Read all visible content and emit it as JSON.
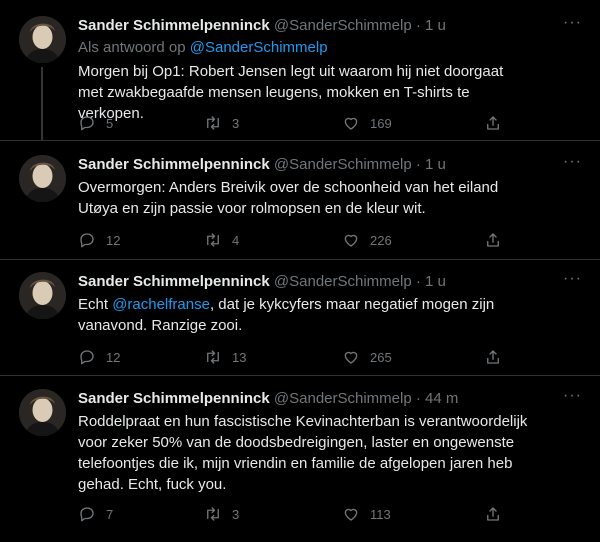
{
  "tweets": [
    {
      "author_name": "Sander Schimmelpenninck",
      "handle": "@SanderSchimmelp",
      "separator": "·",
      "time": "1 u",
      "reply_prefix": "Als antwoord op",
      "reply_mention": "@SanderSchimmelp",
      "text": "Morgen bij Op1: Robert Jensen legt uit waarom hij niet doorgaat met zwakbegaafde mensen leugens, mokken en T-shirts te verkopen.",
      "replies": "5",
      "retweets": "3",
      "likes": "169"
    },
    {
      "author_name": "Sander Schimmelpenninck",
      "handle": "@SanderSchimmelp",
      "separator": "·",
      "time": "1 u",
      "text": "Overmorgen: Anders Breivik over de schoonheid van het eiland Utøya en zijn passie voor rolmopsen en de kleur wit.",
      "replies": "12",
      "retweets": "4",
      "likes": "226"
    },
    {
      "author_name": "Sander Schimmelpenninck",
      "handle": "@SanderSchimmelp",
      "separator": "·",
      "time": "1 u",
      "text_before": "Echt ",
      "text_mention": "@rachelfranse",
      "text_after": ", dat je kykcyfers maar negatief mogen zijn vanavond. Ranzige zooi.",
      "replies": "12",
      "retweets": "13",
      "likes": "265"
    },
    {
      "author_name": "Sander Schimmelpenninck",
      "handle": "@SanderSchimmelp",
      "separator": "·",
      "time": "44 m",
      "text": "Roddelpraat en hun fascistische Kevinachterban is verantwoordelijk voor zeker 50% van de doodsbedreigingen, laster en ongewenste telefoontjes die ik, mijn vriendin en familie de afgelopen jaren heb gehad. Echt, fuck you.",
      "replies": "7",
      "retweets": "3",
      "likes": "113"
    }
  ],
  "more_label": "···",
  "icons": [
    "reply-icon",
    "retweet-icon",
    "like-icon",
    "share-icon",
    "more-icon"
  ],
  "colors": {
    "background": "#000000",
    "text": "#e7e9ea",
    "muted": "#71767b",
    "link": "#1d9bf0",
    "divider": "#2f3336"
  }
}
